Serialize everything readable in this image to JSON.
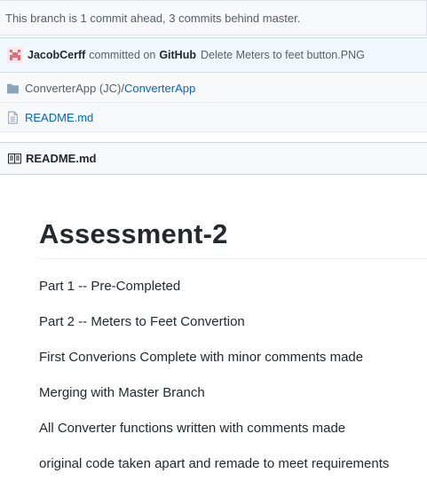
{
  "branch_status": "This branch is 1 commit ahead, 3 commits behind master.",
  "commit": {
    "author": "JacobCerff",
    "verb": "committed on",
    "service": "GitHub",
    "message": "Delete Meters to feet button.PNG"
  },
  "files": [
    {
      "icon": "folder-icon",
      "prefix": "ConverterApp (JC)/",
      "name": "ConverterApp"
    },
    {
      "icon": "file-text-icon",
      "prefix": "",
      "name": "README.md"
    }
  ],
  "readme": {
    "header": "README.md",
    "title": "Assessment-2",
    "paragraphs": [
      "Part 1 -- Pre-Completed",
      "Part 2 -- Meters to Feet Convertion",
      "First Converions Complete with minor comments made",
      "Merging with Master Branch",
      "All Converter functions written with comments made",
      "original code taken apart and remade to meet requirements"
    ]
  },
  "colors": {
    "link": "#0366d6",
    "muted": "#586069",
    "avatar": "#e66b79"
  }
}
